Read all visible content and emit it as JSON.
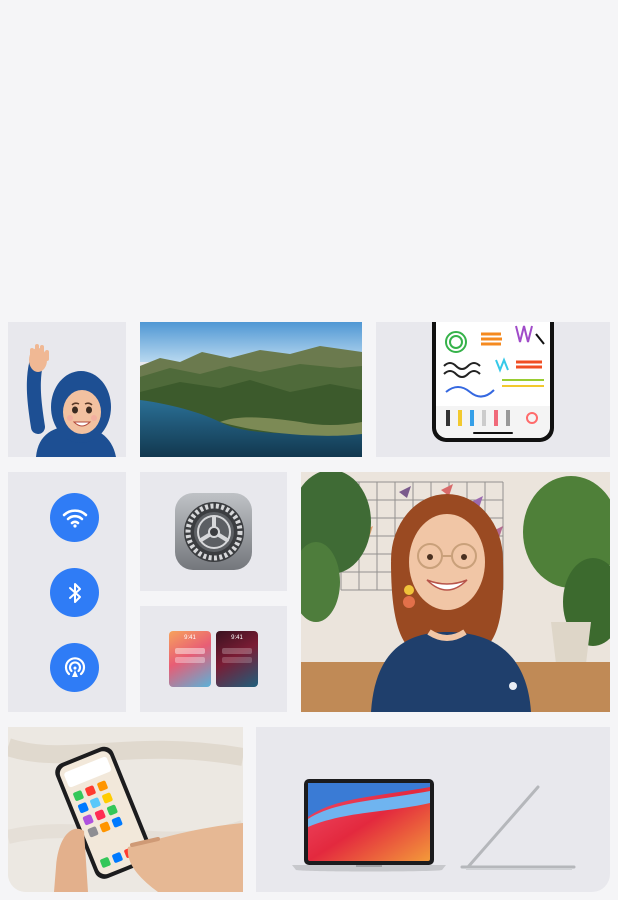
{
  "wallpapers": {
    "light_time": "9:41",
    "dark_time": "9:41"
  },
  "connectivity_icons": [
    "wifi-icon",
    "bluetooth-icon",
    "airdrop-icon"
  ],
  "colors": {
    "page_background": "#f5f5f7",
    "tile_background": "#e8e8ed",
    "accent_blue": "#2f7cf6"
  }
}
